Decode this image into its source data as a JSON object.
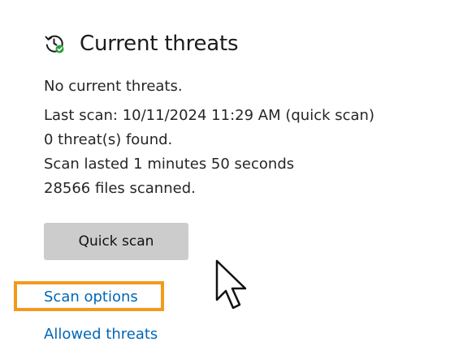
{
  "section": {
    "title": "Current threats",
    "icon": "clock-refresh-check-icon"
  },
  "status": {
    "summary": "No current threats.",
    "last_scan": "Last scan: 10/11/2024 11:29 AM (quick scan)",
    "threats_found": "0 threat(s) found.",
    "duration": "Scan lasted 1 minutes 50 seconds",
    "files_scanned": "28566 files scanned."
  },
  "actions": {
    "quick_scan_label": "Quick scan",
    "scan_options_label": "Scan options",
    "allowed_threats_label": "Allowed threats"
  },
  "colors": {
    "link": "#0067b8",
    "button_bg": "#cccccc",
    "highlight": "#f39a1e",
    "check_green": "#2e9e3e"
  }
}
